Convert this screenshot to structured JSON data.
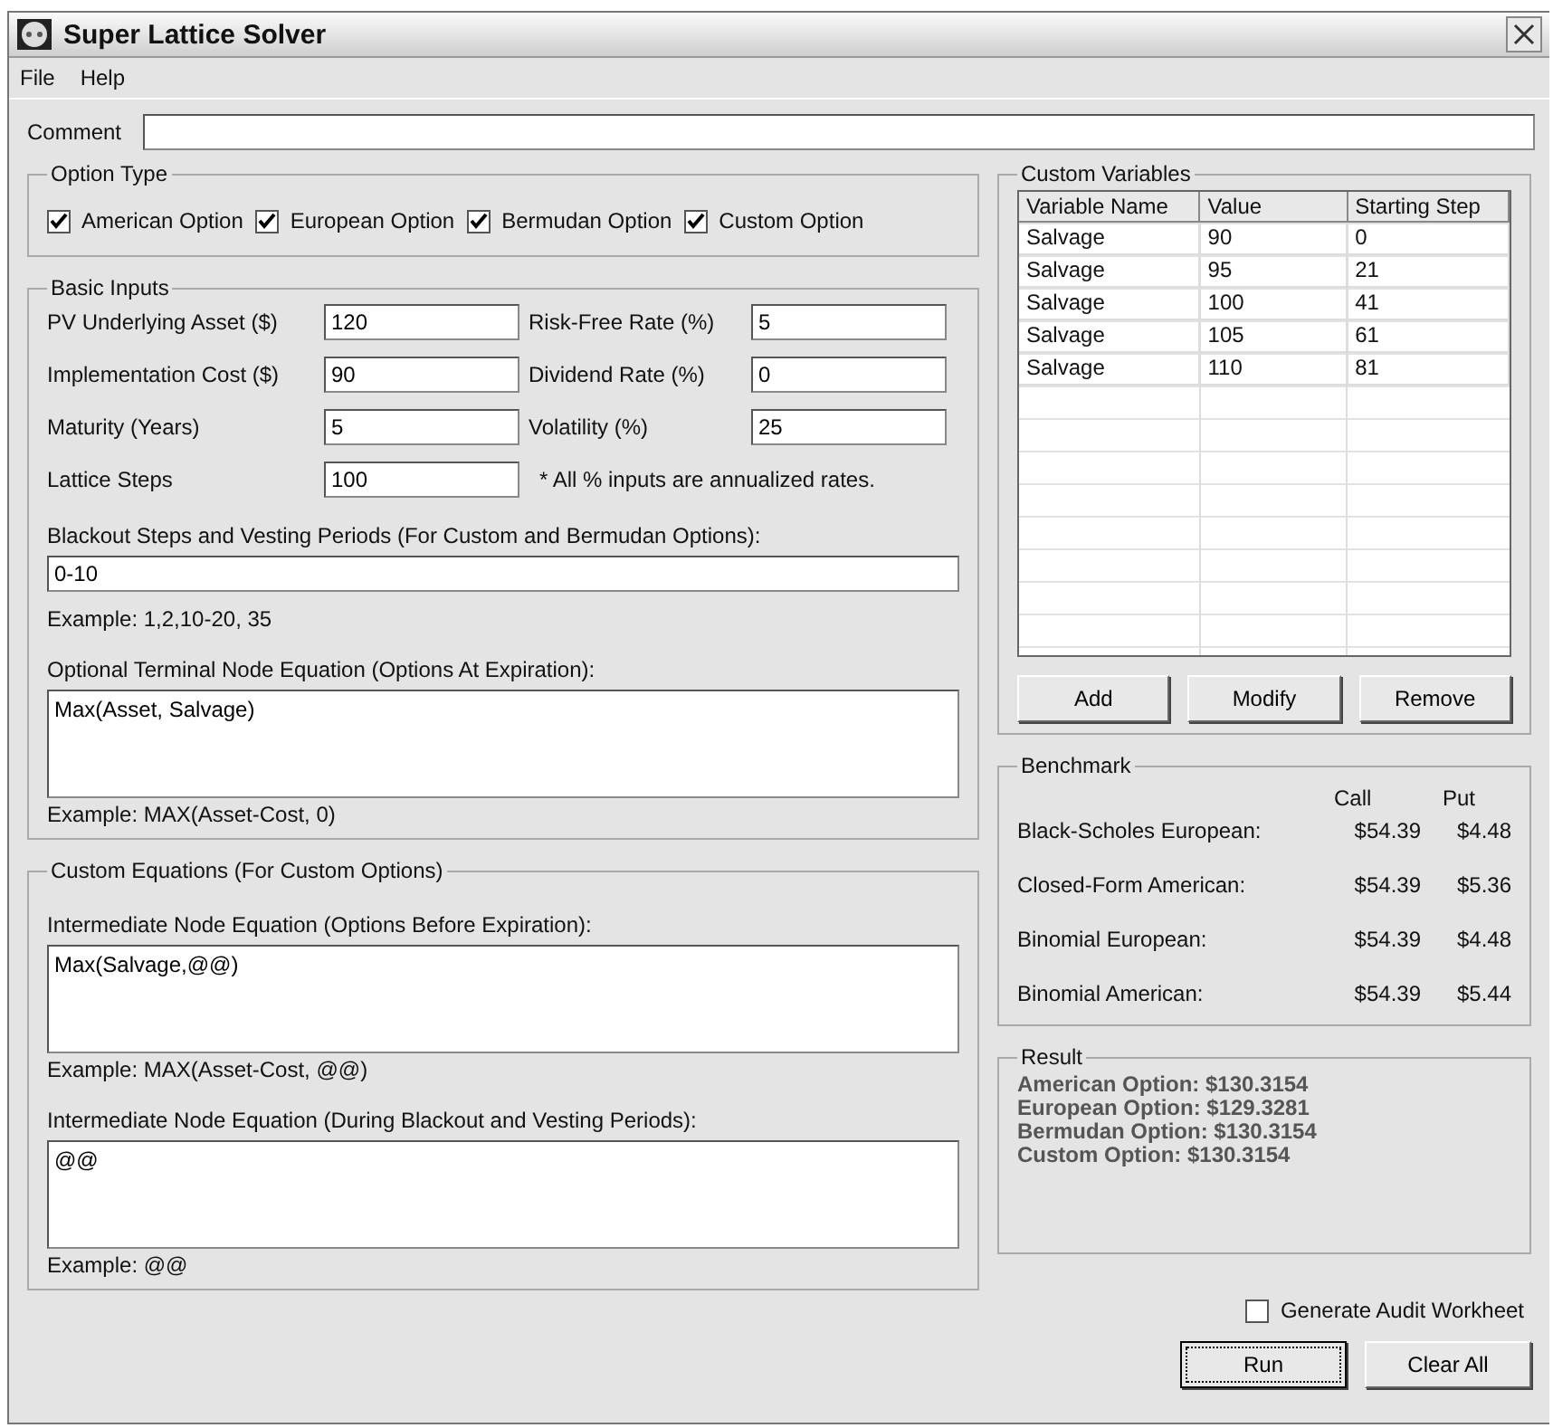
{
  "window": {
    "title": "Super Lattice Solver"
  },
  "menu": [
    {
      "label": "File"
    },
    {
      "label": "Help"
    }
  ],
  "comment": {
    "label": "Comment"
  },
  "option_type": {
    "title": "Option Type",
    "options": [
      {
        "label": "American Option",
        "checked": true
      },
      {
        "label": "European Option",
        "checked": true
      },
      {
        "label": "Bermudan Option",
        "checked": true
      },
      {
        "label": "Custom Option",
        "checked": true
      }
    ]
  },
  "basic_inputs": {
    "title": "Basic Inputs",
    "fields": [
      {
        "label": "PV Underlying Asset ($)",
        "value": "120"
      },
      {
        "label": "Risk-Free Rate (%)",
        "value": "5"
      },
      {
        "label": "Implementation Cost ($)",
        "value": "90"
      },
      {
        "label": "Dividend Rate (%)",
        "value": "0"
      },
      {
        "label": "Maturity (Years)",
        "value": "5"
      },
      {
        "label": "Volatility (%)",
        "value": "25"
      },
      {
        "label": "Lattice Steps",
        "value": "100"
      }
    ],
    "note": "* All % inputs are annualized rates.",
    "blackout": {
      "label": "Blackout Steps and Vesting Periods (For Custom and Bermudan Options):",
      "value": "0-10",
      "example": "Example: 1,2,10-20, 35"
    },
    "terminal": {
      "label": "Optional Terminal Node Equation (Options At Expiration):",
      "value": "Max(Asset, Salvage)",
      "example": "Example: MAX(Asset-Cost, 0)"
    }
  },
  "custom_equations": {
    "title": "Custom Equations (For Custom Options)",
    "equations": [
      {
        "label": "Intermediate Node Equation (Options Before Expiration):",
        "value": "Max(Salvage,@@)",
        "example": "Example: MAX(Asset-Cost, @@)"
      },
      {
        "label": "Intermediate Node Equation (During Blackout and Vesting Periods):",
        "value": "@@",
        "example": "Example: @@"
      }
    ]
  },
  "custom_variables": {
    "title": "Custom Variables",
    "columns": [
      "Variable Name",
      "Value",
      "Starting Step"
    ],
    "rows": [
      [
        "Salvage",
        "90",
        "0"
      ],
      [
        "Salvage",
        "95",
        "21"
      ],
      [
        "Salvage",
        "100",
        "41"
      ],
      [
        "Salvage",
        "105",
        "61"
      ],
      [
        "Salvage",
        "110",
        "81"
      ]
    ],
    "buttons": [
      "Add",
      "Modify",
      "Remove"
    ]
  },
  "benchmark": {
    "title": "Benchmark",
    "columns": [
      "Call",
      "Put"
    ],
    "rows": [
      {
        "label": "Black-Scholes European:",
        "call": "$54.39",
        "put": "$4.48"
      },
      {
        "label": "Closed-Form American:",
        "call": "$54.39",
        "put": "$5.36"
      },
      {
        "label": "Binomial European:",
        "call": "$54.39",
        "put": "$4.48"
      },
      {
        "label": "Binomial American:",
        "call": "$54.39",
        "put": "$5.44"
      }
    ]
  },
  "result": {
    "title": "Result",
    "lines": [
      "American Option: $130.3154",
      "European Option: $129.3281",
      "Bermudan Option: $130.3154",
      "Custom Option: $130.3154"
    ]
  },
  "audit": {
    "label": "Generate Audit Workheet",
    "checked": false
  },
  "actions": [
    {
      "label": "Run",
      "focused": true
    },
    {
      "label": "Clear All",
      "focused": false
    }
  ]
}
